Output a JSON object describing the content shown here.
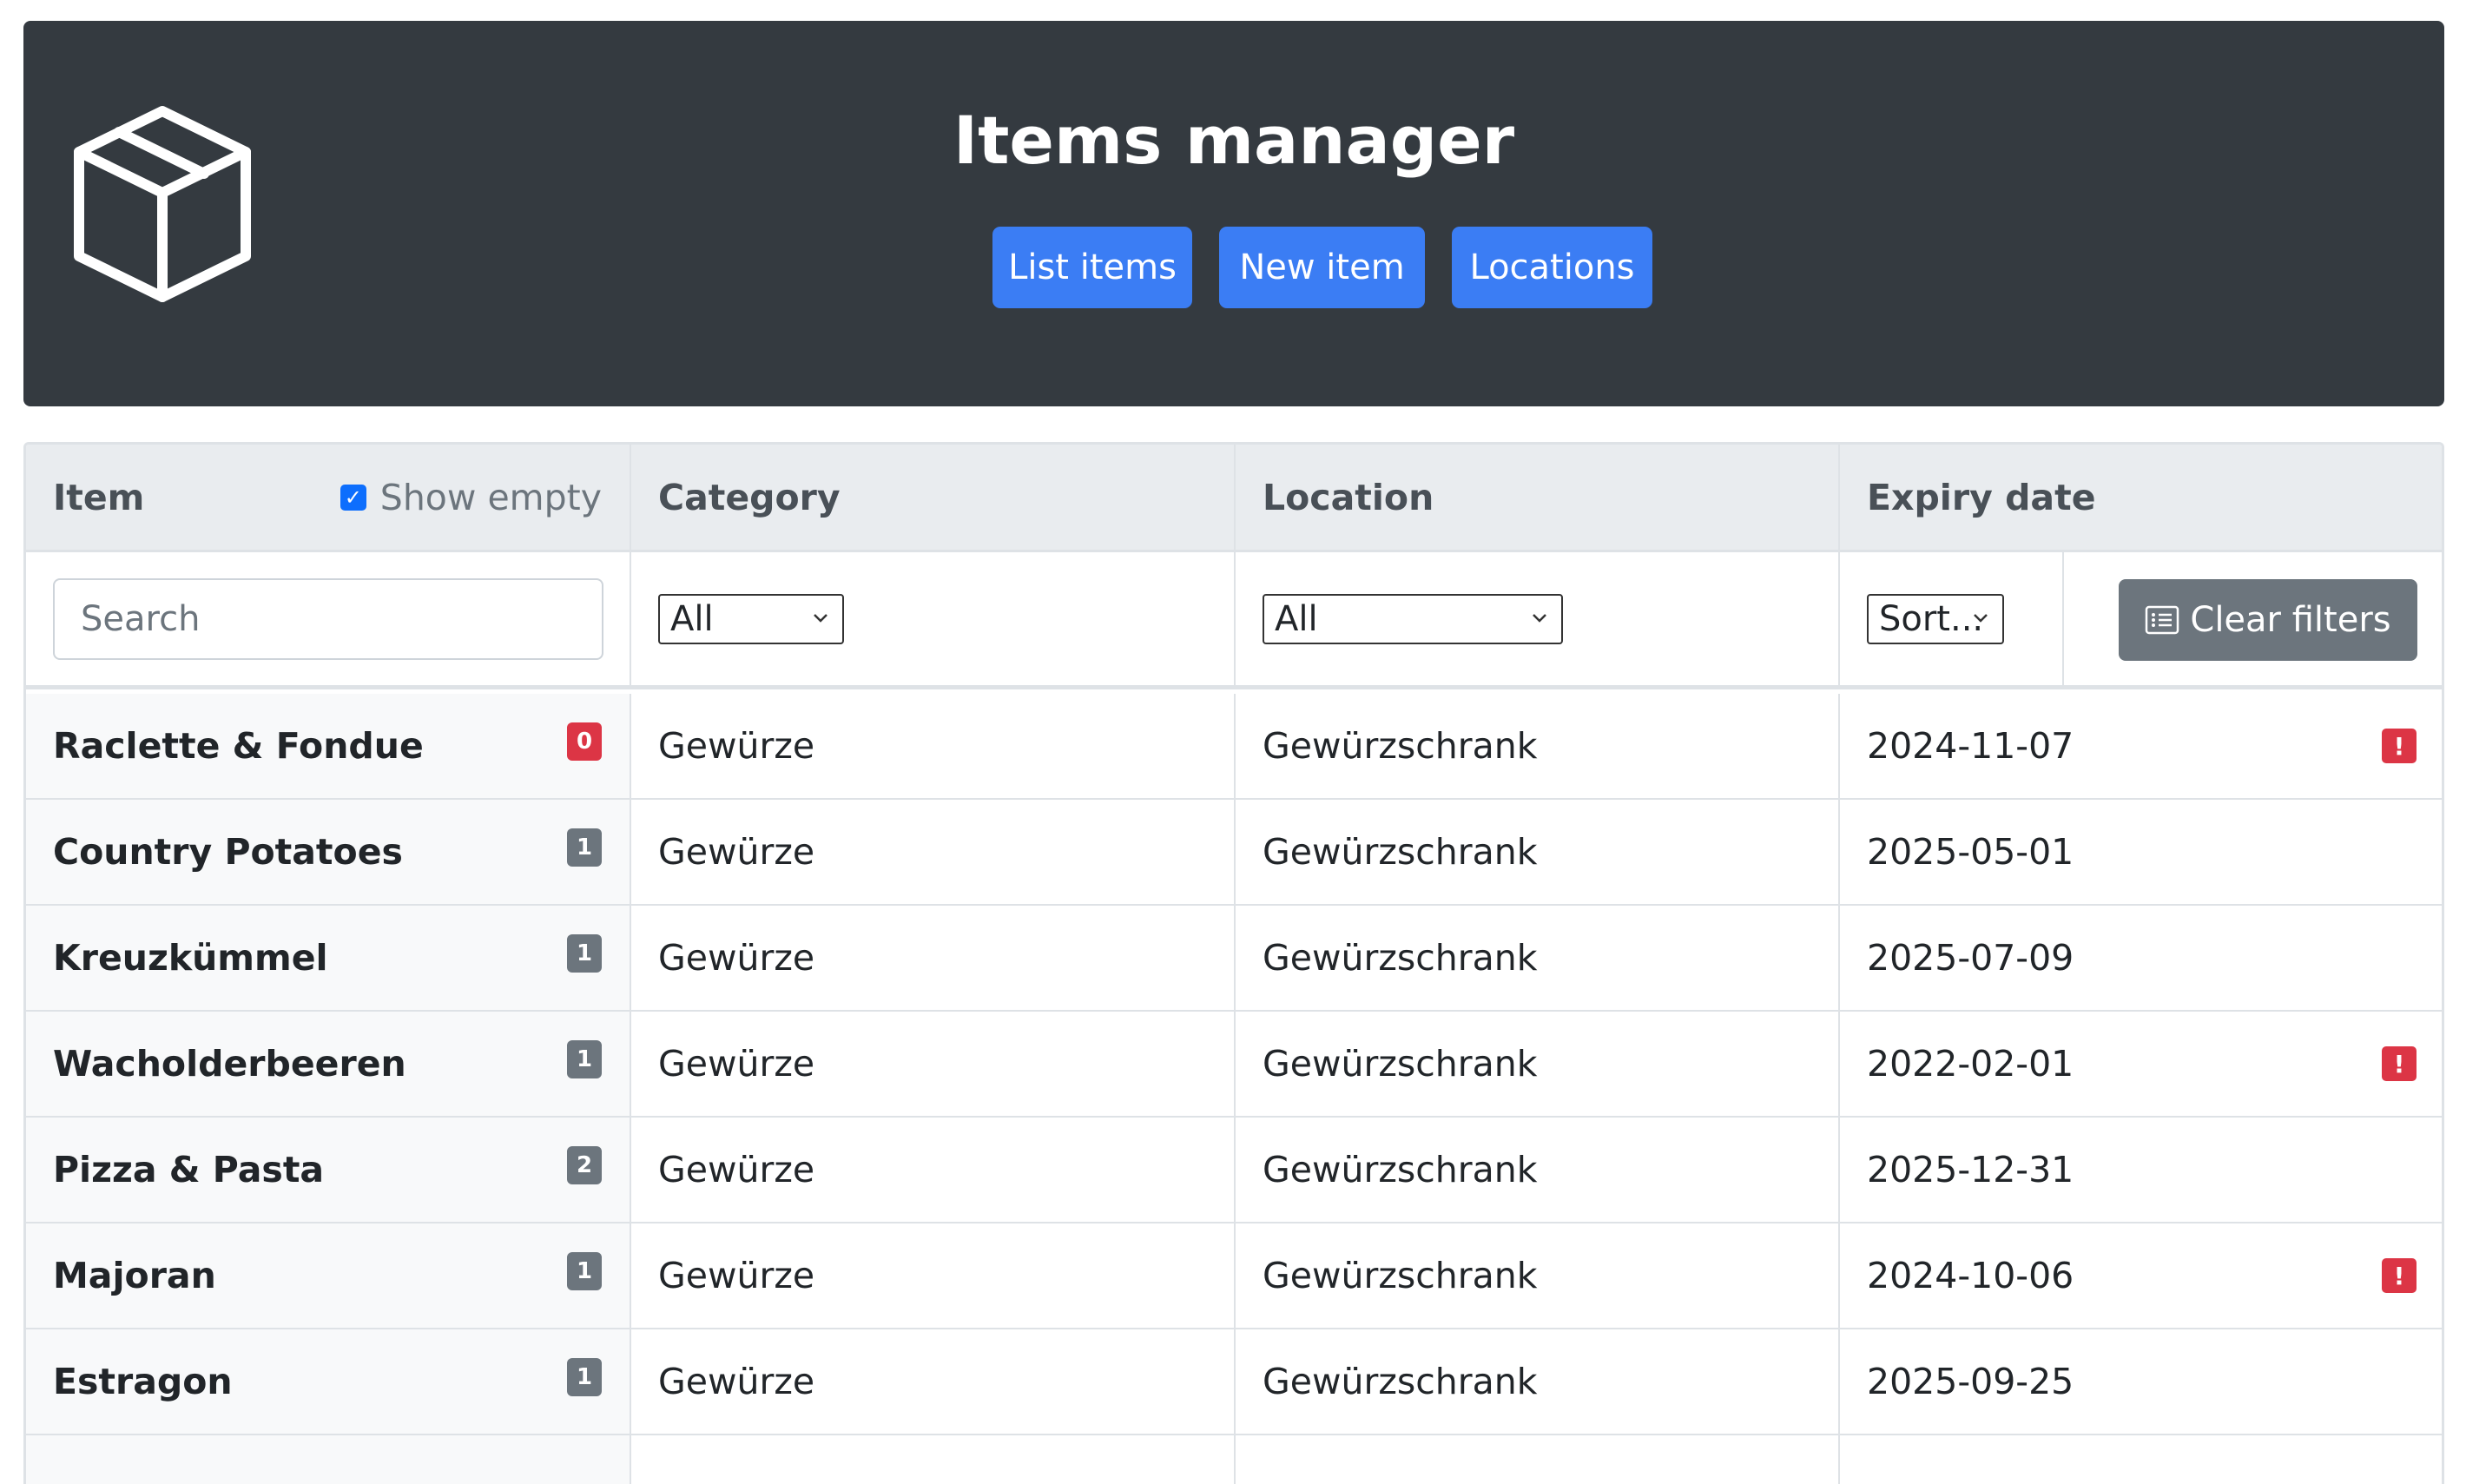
{
  "header": {
    "title": "Items manager",
    "logo_icon": "box-icon",
    "nav": [
      {
        "label": "List items"
      },
      {
        "label": "New item"
      },
      {
        "label": "Locations"
      }
    ]
  },
  "table": {
    "columns": {
      "item": "Item",
      "show_empty": "Show empty",
      "show_empty_checked": true,
      "category": "Category",
      "location": "Location",
      "expiry": "Expiry date"
    },
    "filters": {
      "search_placeholder": "Search",
      "category_selected": "All",
      "location_selected": "All",
      "sort_selected": "Sort...",
      "clear_label": "Clear filters"
    },
    "rows": [
      {
        "name": "Raclette & Fondue",
        "count": "0",
        "category": "Gewürze",
        "location": "Gewürzschrank",
        "expiry": "2024-11-07",
        "expired": true
      },
      {
        "name": "Country Potatoes",
        "count": "1",
        "category": "Gewürze",
        "location": "Gewürzschrank",
        "expiry": "2025-05-01",
        "expired": false
      },
      {
        "name": "Kreuzkümmel",
        "count": "1",
        "category": "Gewürze",
        "location": "Gewürzschrank",
        "expiry": "2025-07-09",
        "expired": false
      },
      {
        "name": "Wacholderbeeren",
        "count": "1",
        "category": "Gewürze",
        "location": "Gewürzschrank",
        "expiry": "2022-02-01",
        "expired": true
      },
      {
        "name": "Pizza & Pasta",
        "count": "2",
        "category": "Gewürze",
        "location": "Gewürzschrank",
        "expiry": "2025-12-31",
        "expired": false
      },
      {
        "name": "Majoran",
        "count": "1",
        "category": "Gewürze",
        "location": "Gewürzschrank",
        "expiry": "2024-10-06",
        "expired": true
      },
      {
        "name": "Estragon",
        "count": "1",
        "category": "Gewürze",
        "location": "Gewürzschrank",
        "expiry": "2025-09-25",
        "expired": false
      }
    ],
    "colors": {
      "expired_badge": "#dc3545",
      "count_badge": "#6c757d",
      "zero_count_badge": "#dc3545",
      "nav_button": "#3b7df4",
      "header_bg": "#343a40"
    },
    "warning_icon": "exclamation-icon"
  }
}
